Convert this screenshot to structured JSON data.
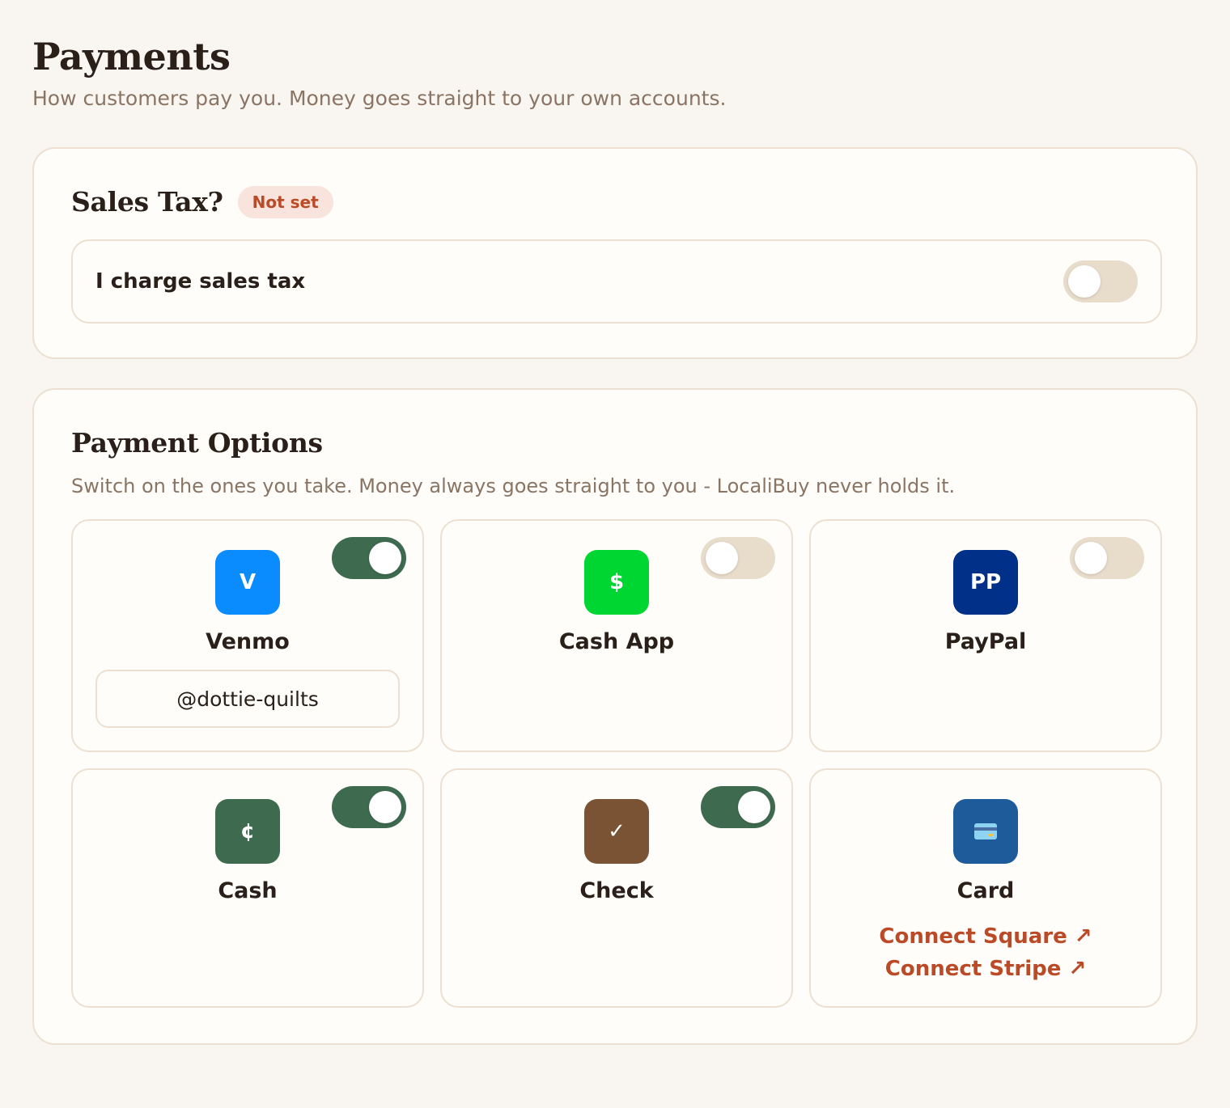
{
  "header": {
    "title": "Payments",
    "subtitle": "How customers pay you. Money goes straight to your own accounts."
  },
  "sales_tax": {
    "title": "Sales Tax?",
    "badge": "Not set",
    "toggle_label": "I charge sales tax",
    "enabled": false
  },
  "payment_options": {
    "title": "Payment Options",
    "subtitle": "Switch on the ones you take. Money always goes straight to you - LocaliBuy never holds it.",
    "methods": [
      {
        "name": "Venmo",
        "icon_text": "V",
        "icon": "venmo-icon",
        "color": "#0a8cff",
        "enabled": true,
        "handle_value": "@dottie-quilts"
      },
      {
        "name": "Cash App",
        "icon_text": "$",
        "icon": "cashapp-icon",
        "color": "#00d632",
        "enabled": false
      },
      {
        "name": "PayPal",
        "icon_text": "PP",
        "icon": "paypal-icon",
        "color": "#003087",
        "enabled": false
      },
      {
        "name": "Cash",
        "icon_text": "¢",
        "icon": "cash-icon",
        "color": "#3e6b4f",
        "enabled": true
      },
      {
        "name": "Check",
        "icon_text": "✓",
        "icon": "check-icon",
        "color": "#7a5335",
        "enabled": true
      },
      {
        "name": "Card",
        "icon": "credit-card-icon",
        "color": "#1e5b9b",
        "links": [
          "Connect Square ↗",
          "Connect Stripe ↗"
        ]
      }
    ]
  },
  "colors": {
    "background": "#f9f6f1",
    "card": "#fffdf9",
    "border": "#ebe0d1",
    "toggle_on": "#3e6b4f",
    "toggle_off": "#e8dccb",
    "accent": "#bb4a26",
    "muted_text": "#8a7565"
  }
}
